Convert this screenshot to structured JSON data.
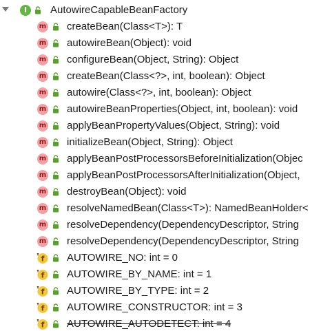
{
  "tree": {
    "root": {
      "label": "AutowireCapableBeanFactory",
      "icon": "interface-icon",
      "icon_letter": "I",
      "expanded": true
    },
    "members": [
      {
        "label": "createBean(Class<T>): T",
        "kind": "method",
        "icon_letter": "m",
        "deprecated": false
      },
      {
        "label": "autowireBean(Object): void",
        "kind": "method",
        "icon_letter": "m",
        "deprecated": false
      },
      {
        "label": "configureBean(Object, String): Object",
        "kind": "method",
        "icon_letter": "m",
        "deprecated": false
      },
      {
        "label": "createBean(Class<?>, int, boolean): Object",
        "kind": "method",
        "icon_letter": "m",
        "deprecated": false
      },
      {
        "label": "autowire(Class<?>, int, boolean): Object",
        "kind": "method",
        "icon_letter": "m",
        "deprecated": false
      },
      {
        "label": "autowireBeanProperties(Object, int, boolean): void",
        "kind": "method",
        "icon_letter": "m",
        "deprecated": false
      },
      {
        "label": "applyBeanPropertyValues(Object, String): void",
        "kind": "method",
        "icon_letter": "m",
        "deprecated": false
      },
      {
        "label": "initializeBean(Object, String): Object",
        "kind": "method",
        "icon_letter": "m",
        "deprecated": false
      },
      {
        "label": "applyBeanPostProcessorsBeforeInitialization(Objec",
        "kind": "method",
        "icon_letter": "m",
        "deprecated": false
      },
      {
        "label": "applyBeanPostProcessorsAfterInitialization(Object,",
        "kind": "method",
        "icon_letter": "m",
        "deprecated": false
      },
      {
        "label": "destroyBean(Object): void",
        "kind": "method",
        "icon_letter": "m",
        "deprecated": false
      },
      {
        "label": "resolveNamedBean(Class<T>): NamedBeanHolder<",
        "kind": "method",
        "icon_letter": "m",
        "deprecated": false
      },
      {
        "label": "resolveDependency(DependencyDescriptor, String",
        "kind": "method",
        "icon_letter": "m",
        "deprecated": false
      },
      {
        "label": "resolveDependency(DependencyDescriptor, String",
        "kind": "method",
        "icon_letter": "m",
        "deprecated": false
      },
      {
        "label": "AUTOWIRE_NO: int = 0",
        "kind": "field",
        "icon_letter": "f",
        "deprecated": false
      },
      {
        "label": "AUTOWIRE_BY_NAME: int = 1",
        "kind": "field",
        "icon_letter": "f",
        "deprecated": false
      },
      {
        "label": "AUTOWIRE_BY_TYPE: int = 2",
        "kind": "field",
        "icon_letter": "f",
        "deprecated": false
      },
      {
        "label": "AUTOWIRE_CONSTRUCTOR: int = 3",
        "kind": "field",
        "icon_letter": "f",
        "deprecated": false
      },
      {
        "label": "AUTOWIRE_AUTODETECT: int = 4",
        "kind": "field",
        "icon_letter": "f",
        "deprecated": true
      }
    ]
  },
  "colors": {
    "interface_icon": "#62b543",
    "method_icon": "#f3a0a5",
    "field_icon": "#f4c542",
    "lock_green": "#5aa02c"
  }
}
